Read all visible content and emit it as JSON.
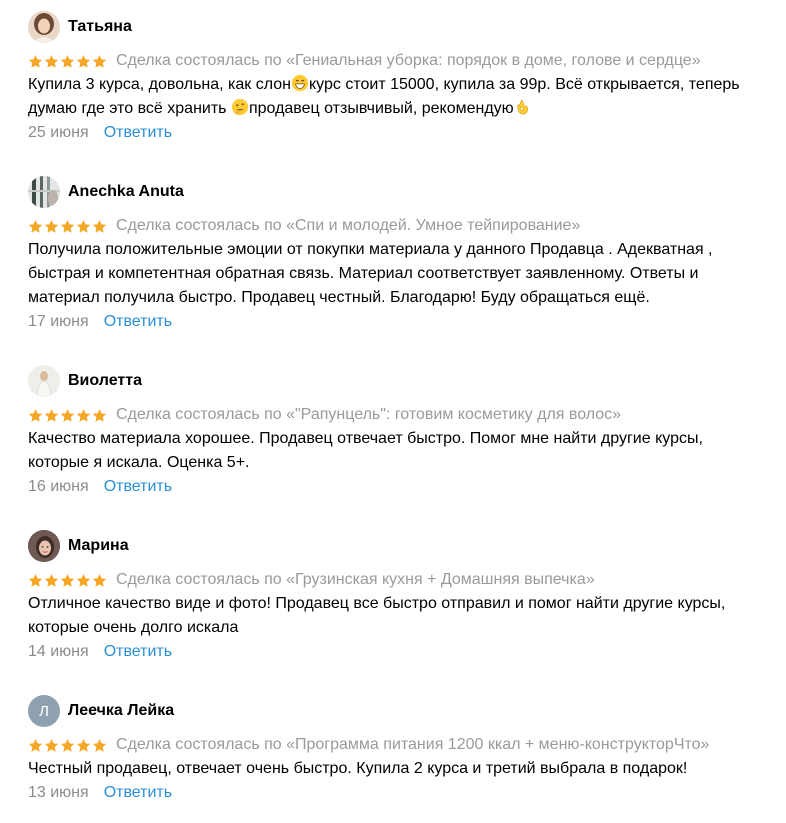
{
  "reviews": [
    {
      "name": "Татьяна",
      "stars": 5,
      "deal": "Сделка состоялась по «Гениальная уборка: порядок в доме, голове и сердце»",
      "text_parts": [
        "Купила 3 курса, довольна, как слон",
        "курс стоит 15000, купила за 99р. Всё открывается, теперь думаю где это всё хранить ",
        "продавец отзывчивый, рекомендую"
      ],
      "emojis": [
        "grin-emoji",
        "thinking-emoji",
        "ok-hand-emoji"
      ],
      "date": "25 июня",
      "reply": "Ответить"
    },
    {
      "name": "Anechka Anuta",
      "stars": 5,
      "deal": "Сделка состоялась по «Спи и молодей. Умное тейпирование»",
      "text": "Получила положительные эмоции от покупки материала у данного Продавца . Адекватная , быстрая и компетентная обратная связь. Материал соответствует заявленному. Ответы и материал получила быстро. Продавец честный. Благодарю! Буду обращаться ещё.",
      "date": "17 июня",
      "reply": "Ответить"
    },
    {
      "name": "Виолетта",
      "stars": 5,
      "deal": "Сделка состоялась по «\"Рапунцель\": готовим косметику для волос»",
      "text": "Качество материала хорошее. Продавец отвечает быстро. Помог мне найти другие курсы, которые я искала. Оценка 5+.",
      "date": "16 июня",
      "reply": "Ответить"
    },
    {
      "name": "Марина",
      "stars": 5,
      "deal": "Сделка состоялась по «Грузинская кухня + Домашняя выпечка»",
      "text": "Отличное качество виде и фото! Продавец все быстро отправил и помог найти другие курсы, которые очень долго искала",
      "date": "14 июня",
      "reply": "Ответить"
    },
    {
      "name": "Леечка Лейка",
      "avatar_letter": "Л",
      "stars": 5,
      "deal": "Сделка состоялась по «Программа питания 1200 ккал + меню-конструкторЧто»",
      "text": "Честный продавец, отвечает очень быстро. Купила 2 курса и третий выбрала в подарок!",
      "date": "13 июня",
      "reply": "Ответить"
    }
  ],
  "colors": {
    "star": "#f5a623",
    "deal_text": "#9a9a9a",
    "date_text": "#8c8c8c",
    "reply_link": "#2a8fd5",
    "letter_avatar_bg": "#8fa0b1"
  }
}
